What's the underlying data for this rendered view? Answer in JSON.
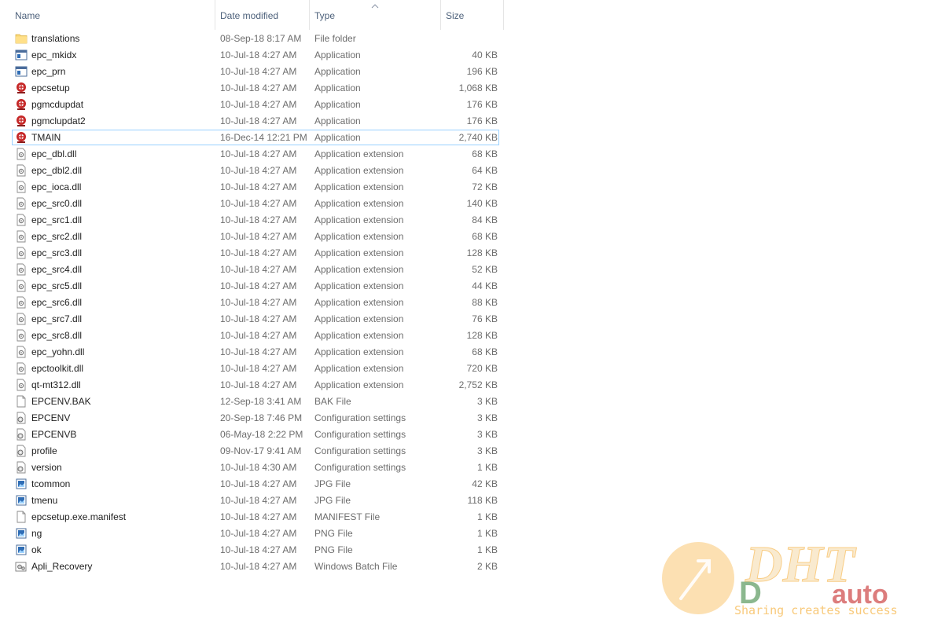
{
  "columns": {
    "name": "Name",
    "date": "Date modified",
    "type": "Type",
    "size": "Size"
  },
  "files": [
    {
      "name": "translations",
      "date": "08-Sep-18 8:17 AM",
      "type": "File folder",
      "size": "",
      "icon": "folder-icon"
    },
    {
      "name": "epc_mkidx",
      "date": "10-Jul-18 4:27 AM",
      "type": "Application",
      "size": "40 KB",
      "icon": "app-window-icon"
    },
    {
      "name": "epc_prn",
      "date": "10-Jul-18 4:27 AM",
      "type": "Application",
      "size": "196 KB",
      "icon": "app-window-icon"
    },
    {
      "name": "epcsetup",
      "date": "10-Jul-18 4:27 AM",
      "type": "Application",
      "size": "1,068 KB",
      "icon": "red-app-icon"
    },
    {
      "name": "pgmcdupdat",
      "date": "10-Jul-18 4:27 AM",
      "type": "Application",
      "size": "176 KB",
      "icon": "red-app-icon"
    },
    {
      "name": "pgmclupdat2",
      "date": "10-Jul-18 4:27 AM",
      "type": "Application",
      "size": "176 KB",
      "icon": "red-app-icon"
    },
    {
      "name": "TMAIN",
      "date": "16-Dec-14 12:21 PM",
      "type": "Application",
      "size": "2,740 KB",
      "icon": "red-app-icon",
      "selected": true
    },
    {
      "name": "epc_dbl.dll",
      "date": "10-Jul-18 4:27 AM",
      "type": "Application extension",
      "size": "68 KB",
      "icon": "dll-icon"
    },
    {
      "name": "epc_dbl2.dll",
      "date": "10-Jul-18 4:27 AM",
      "type": "Application extension",
      "size": "64 KB",
      "icon": "dll-icon"
    },
    {
      "name": "epc_ioca.dll",
      "date": "10-Jul-18 4:27 AM",
      "type": "Application extension",
      "size": "72 KB",
      "icon": "dll-icon"
    },
    {
      "name": "epc_src0.dll",
      "date": "10-Jul-18 4:27 AM",
      "type": "Application extension",
      "size": "140 KB",
      "icon": "dll-icon"
    },
    {
      "name": "epc_src1.dll",
      "date": "10-Jul-18 4:27 AM",
      "type": "Application extension",
      "size": "84 KB",
      "icon": "dll-icon"
    },
    {
      "name": "epc_src2.dll",
      "date": "10-Jul-18 4:27 AM",
      "type": "Application extension",
      "size": "68 KB",
      "icon": "dll-icon"
    },
    {
      "name": "epc_src3.dll",
      "date": "10-Jul-18 4:27 AM",
      "type": "Application extension",
      "size": "128 KB",
      "icon": "dll-icon"
    },
    {
      "name": "epc_src4.dll",
      "date": "10-Jul-18 4:27 AM",
      "type": "Application extension",
      "size": "52 KB",
      "icon": "dll-icon"
    },
    {
      "name": "epc_src5.dll",
      "date": "10-Jul-18 4:27 AM",
      "type": "Application extension",
      "size": "44 KB",
      "icon": "dll-icon"
    },
    {
      "name": "epc_src6.dll",
      "date": "10-Jul-18 4:27 AM",
      "type": "Application extension",
      "size": "88 KB",
      "icon": "dll-icon"
    },
    {
      "name": "epc_src7.dll",
      "date": "10-Jul-18 4:27 AM",
      "type": "Application extension",
      "size": "76 KB",
      "icon": "dll-icon"
    },
    {
      "name": "epc_src8.dll",
      "date": "10-Jul-18 4:27 AM",
      "type": "Application extension",
      "size": "128 KB",
      "icon": "dll-icon"
    },
    {
      "name": "epc_yohn.dll",
      "date": "10-Jul-18 4:27 AM",
      "type": "Application extension",
      "size": "68 KB",
      "icon": "dll-icon"
    },
    {
      "name": "epctoolkit.dll",
      "date": "10-Jul-18 4:27 AM",
      "type": "Application extension",
      "size": "720 KB",
      "icon": "dll-icon"
    },
    {
      "name": "qt-mt312.dll",
      "date": "10-Jul-18 4:27 AM",
      "type": "Application extension",
      "size": "2,752 KB",
      "icon": "dll-icon"
    },
    {
      "name": "EPCENV.BAK",
      "date": "12-Sep-18 3:41 AM",
      "type": "BAK File",
      "size": "3 KB",
      "icon": "blank-file-icon"
    },
    {
      "name": "EPCENV",
      "date": "20-Sep-18 7:46 PM",
      "type": "Configuration settings",
      "size": "3 KB",
      "icon": "config-file-icon"
    },
    {
      "name": "EPCENVB",
      "date": "06-May-18 2:22 PM",
      "type": "Configuration settings",
      "size": "3 KB",
      "icon": "config-file-icon"
    },
    {
      "name": "profile",
      "date": "09-Nov-17 9:41 AM",
      "type": "Configuration settings",
      "size": "3 KB",
      "icon": "config-file-icon"
    },
    {
      "name": "version",
      "date": "10-Jul-18 4:30 AM",
      "type": "Configuration settings",
      "size": "1 KB",
      "icon": "config-file-icon"
    },
    {
      "name": "tcommon",
      "date": "10-Jul-18 4:27 AM",
      "type": "JPG File",
      "size": "42 KB",
      "icon": "image-file-icon"
    },
    {
      "name": "tmenu",
      "date": "10-Jul-18 4:27 AM",
      "type": "JPG File",
      "size": "118 KB",
      "icon": "image-file-icon"
    },
    {
      "name": "epcsetup.exe.manifest",
      "date": "10-Jul-18 4:27 AM",
      "type": "MANIFEST File",
      "size": "1 KB",
      "icon": "blank-file-icon"
    },
    {
      "name": "ng",
      "date": "10-Jul-18 4:27 AM",
      "type": "PNG File",
      "size": "1 KB",
      "icon": "image-file-icon"
    },
    {
      "name": "ok",
      "date": "10-Jul-18 4:27 AM",
      "type": "PNG File",
      "size": "1 KB",
      "icon": "image-file-icon"
    },
    {
      "name": "Apli_Recovery",
      "date": "10-Jul-18 4:27 AM",
      "type": "Windows Batch File",
      "size": "2 KB",
      "icon": "batch-file-icon"
    }
  ],
  "watermark": {
    "brand": "DHT",
    "brand_suffix": "auto",
    "slogan": "Sharing creates success"
  },
  "colors": {
    "header_text": "#4c607a",
    "secondary_text": "#6d6d6d",
    "selection_border": "#99d1ff",
    "folder": "#f8d775",
    "app_red": "#c62828",
    "watermark_orange": "#f5a623"
  }
}
